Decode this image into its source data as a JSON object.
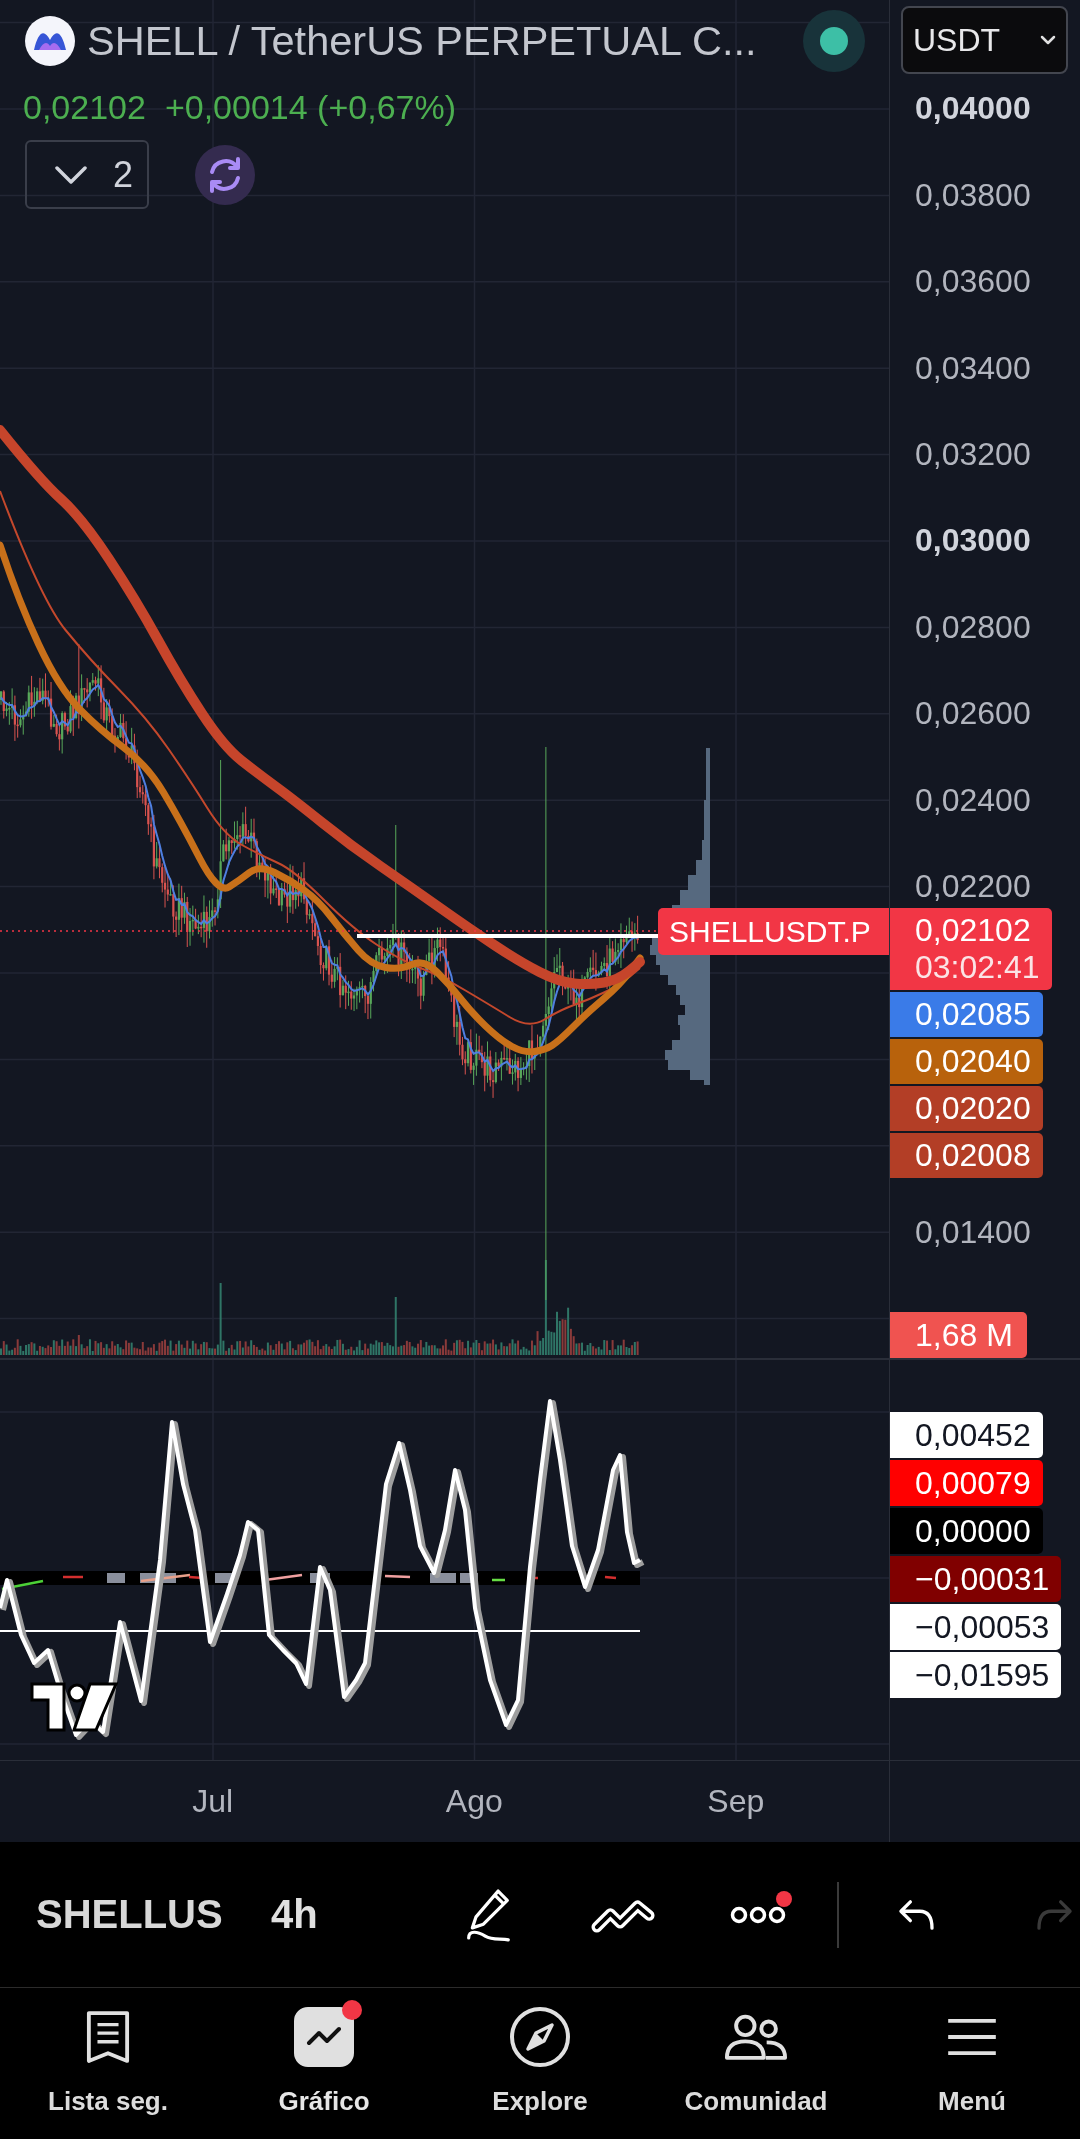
{
  "header": {
    "title": "SHELL / TetherUS PERPETUAL C...",
    "live": true,
    "currency": "USDT",
    "last_price": "0,02102",
    "change": "+0,00014 (+0,67%)",
    "indicator_count": "2"
  },
  "price_axis": {
    "upper_labels": [
      {
        "text": "0,04000",
        "major": true
      },
      {
        "text": "0,03800",
        "major": false
      },
      {
        "text": "0,03600",
        "major": false
      },
      {
        "text": "0,03400",
        "major": false
      },
      {
        "text": "0,03200",
        "major": false
      },
      {
        "text": "0,03000",
        "major": true
      },
      {
        "text": "0,02800",
        "major": false
      },
      {
        "text": "0,02600",
        "major": false
      },
      {
        "text": "0,02400",
        "major": false
      },
      {
        "text": "0,02200",
        "major": false
      }
    ],
    "lower_labels": [
      {
        "text": "0,01400",
        "major": false
      }
    ]
  },
  "symbol_label": "SHELLUSDT.P",
  "price_tags": [
    {
      "value": "0,02102",
      "countdown": "03:02:41",
      "color": "#f23645"
    },
    {
      "value": "0,02085",
      "color": "#3a7be8"
    },
    {
      "value": "0,02040",
      "color": "#b8620c"
    },
    {
      "value": "0,02020",
      "color": "#b33e26"
    },
    {
      "value": "0,02008",
      "color": "#b33e26"
    }
  ],
  "volume_tag": "1,68 M",
  "oscillator_tags": [
    {
      "value": "0,00452",
      "color": "#ffffff"
    },
    {
      "value": "0,00079",
      "color": "#ff0000"
    },
    {
      "value": "0,00000",
      "color": "#000000"
    },
    {
      "value": "−0,00031",
      "color": "#800000"
    },
    {
      "value": "−0,00053",
      "color": "#ffffff"
    },
    {
      "value": "−0,01595",
      "color": "#ffffff"
    }
  ],
  "time_axis": [
    "Jul",
    "Ago",
    "Sep"
  ],
  "toolbar": {
    "symbol": "SHELLUS",
    "interval": "4h",
    "tools": [
      {
        "kind": "draw",
        "badge": false,
        "disabled": false
      },
      {
        "kind": "patterns",
        "badge": false,
        "disabled": false
      },
      {
        "kind": "more",
        "badge": true,
        "disabled": false
      },
      {
        "kind": "undo",
        "badge": false,
        "disabled": false
      },
      {
        "kind": "redo",
        "badge": false,
        "disabled": true
      }
    ]
  },
  "nav": [
    {
      "label": "Lista seg.",
      "kind": "watchlist",
      "selected": false,
      "badge": false
    },
    {
      "label": "Gráfico",
      "kind": "chart",
      "selected": true,
      "badge": true
    },
    {
      "label": "Explore",
      "kind": "explore",
      "selected": false,
      "badge": false
    },
    {
      "label": "Comunidad",
      "kind": "community",
      "selected": false,
      "badge": false
    },
    {
      "label": "Menú",
      "kind": "menu",
      "selected": false,
      "badge": false
    }
  ]
}
